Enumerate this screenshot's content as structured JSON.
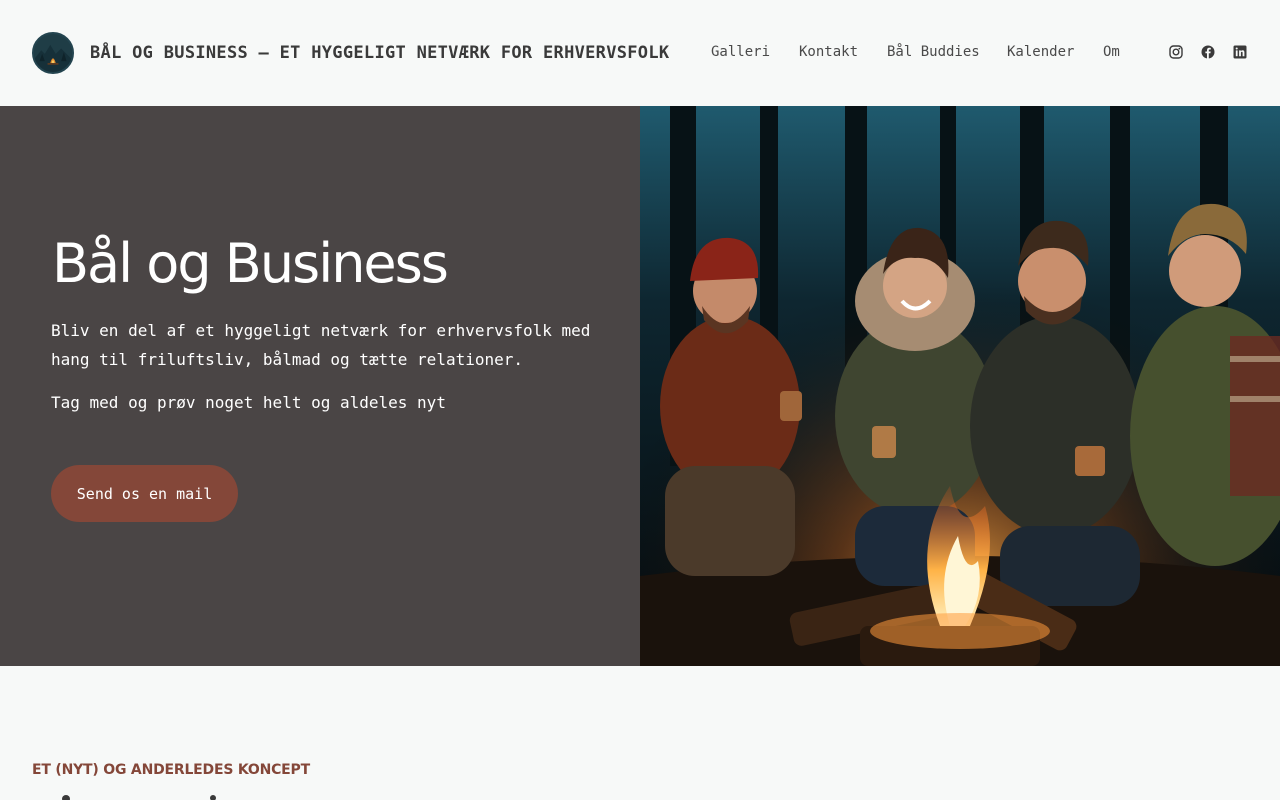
{
  "header": {
    "site_title": "BÅL OG BUSINESS – ET HYGGELIGT NETVÆRK FOR ERHVERVSFOLK",
    "nav": [
      "Galleri",
      "Kontakt",
      "Bål Buddies",
      "Kalender",
      "Om"
    ],
    "social_icons": [
      "instagram-icon",
      "facebook-icon",
      "linkedin-icon"
    ]
  },
  "hero": {
    "title": "Bål og Business",
    "paragraph": "Bliv en del af et hyggeligt netværk for erhvervsfolk med hang til friluftsliv, bålmad og tætte relationer.",
    "paragraph2": "Tag med og prøv noget helt og aldeles nyt",
    "cta_label": "Send os en mail"
  },
  "section": {
    "kicker": "ET (NYT) OG ANDERLEDES KONCEPT"
  },
  "colors": {
    "accent": "#844739",
    "hero_bg": "#4a4545",
    "page_bg": "#f7f9f8"
  }
}
